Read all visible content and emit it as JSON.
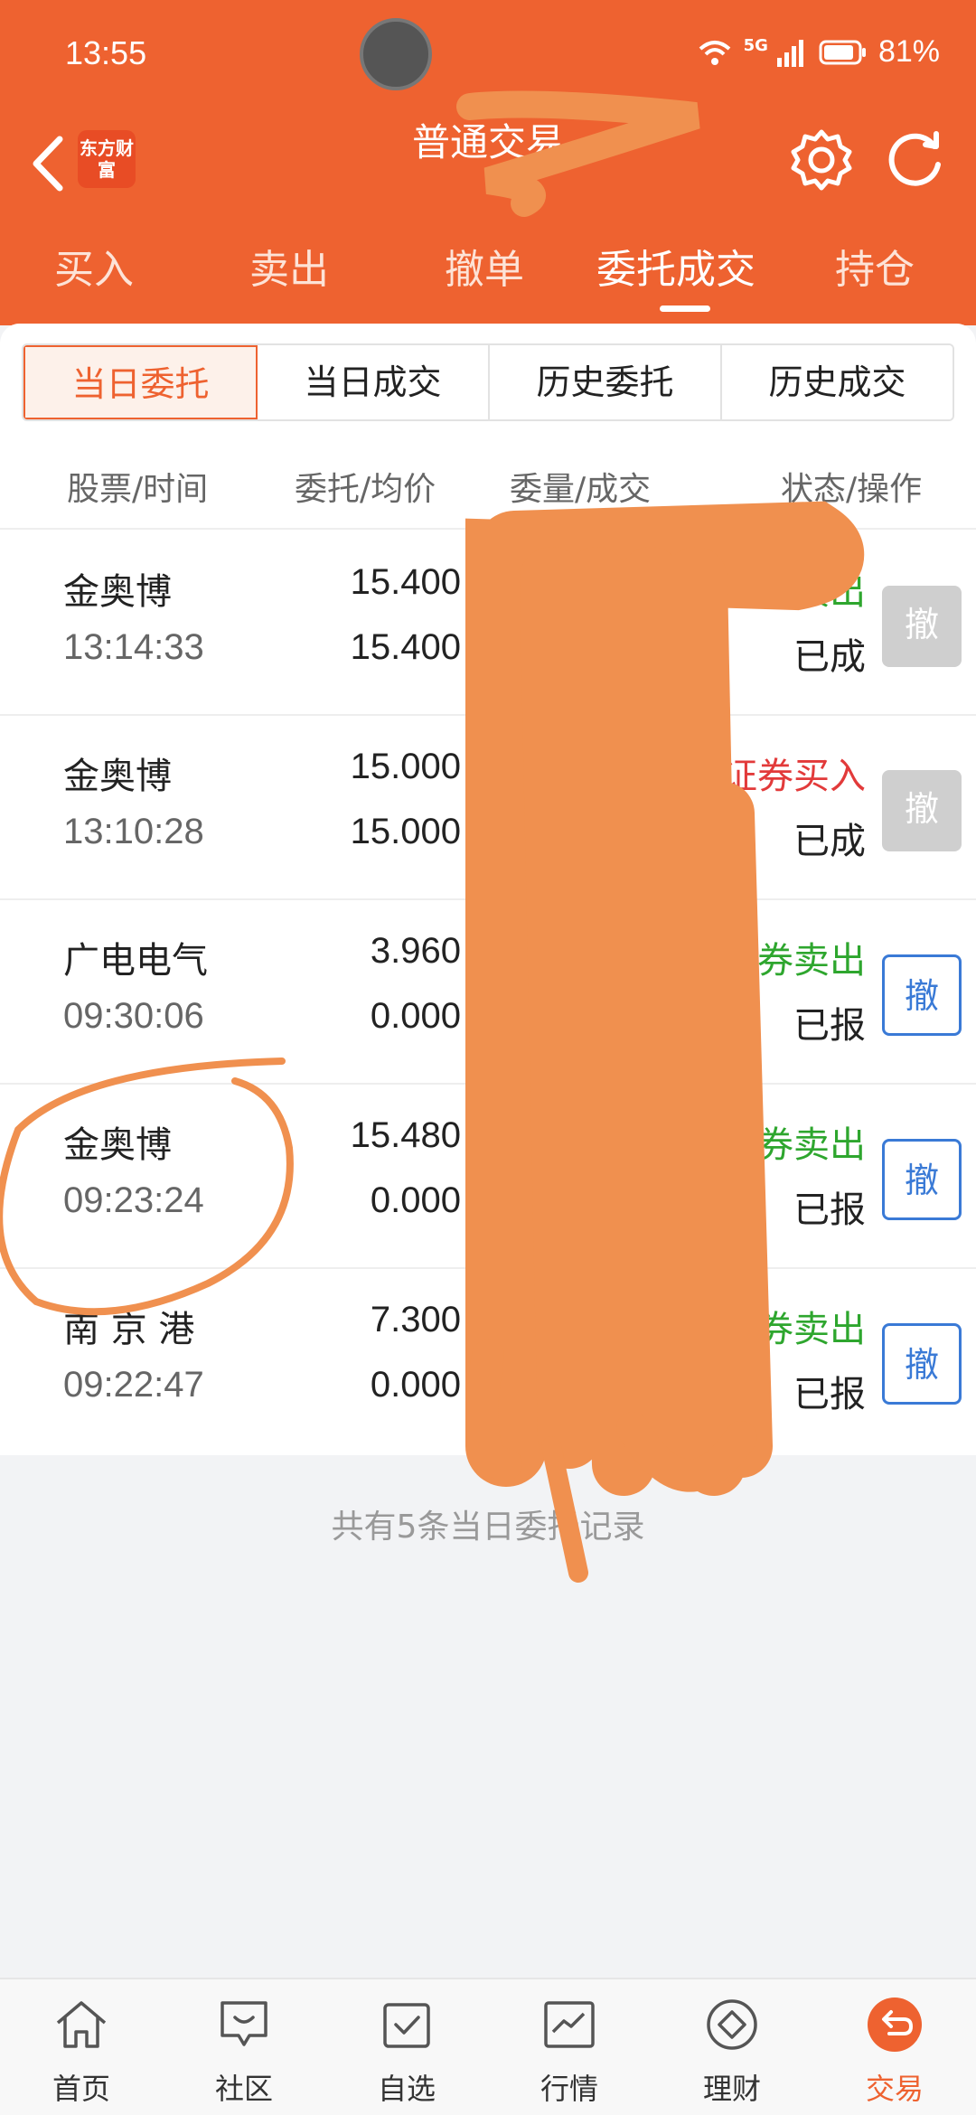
{
  "status_bar": {
    "time": "13:55",
    "network": "5G",
    "battery": "81%"
  },
  "header": {
    "logo_text": "东方财富",
    "title": "普通交易",
    "tabs": [
      {
        "label": "买入",
        "active": false
      },
      {
        "label": "卖出",
        "active": false
      },
      {
        "label": "撤单",
        "active": false
      },
      {
        "label": "委托成交",
        "active": true
      },
      {
        "label": "持仓",
        "active": false
      }
    ]
  },
  "segments": [
    {
      "label": "当日委托",
      "active": true
    },
    {
      "label": "当日成交",
      "active": false
    },
    {
      "label": "历史委托",
      "active": false
    },
    {
      "label": "历史成交",
      "active": false
    }
  ],
  "columns": {
    "stock_time": "股票/时间",
    "price_avg": "委托/均价",
    "qty_filled": "委量/成交",
    "status_op": "状态/操作"
  },
  "orders": [
    {
      "name": "金奥博",
      "time": "13:14:33",
      "price": "15.400",
      "avg": "15.400",
      "side": "证券卖出",
      "side_color": "#2ea62e",
      "status": "已成",
      "cancel_label": "撤",
      "cancel_enabled": false
    },
    {
      "name": "金奥博",
      "time": "13:10:28",
      "price": "15.000",
      "avg": "15.000",
      "side": "证券买入",
      "side_color": "#e23a3a",
      "status": "已成",
      "cancel_label": "撤",
      "cancel_enabled": false
    },
    {
      "name": "广电电气",
      "time": "09:30:06",
      "price": "3.960",
      "avg": "0.000",
      "side": "证券卖出",
      "side_color": "#2ea62e",
      "status": "已报",
      "cancel_label": "撤",
      "cancel_enabled": true
    },
    {
      "name": "金奥博",
      "time": "09:23:24",
      "price": "15.480",
      "avg": "0.000",
      "side": "证券卖出",
      "side_color": "#2ea62e",
      "status": "已报",
      "cancel_label": "撤",
      "cancel_enabled": true
    },
    {
      "name": "南 京 港",
      "time": "09:22:47",
      "price": "7.300",
      "avg": "0.000",
      "side": "证券卖出",
      "side_color": "#2ea62e",
      "status": "已报",
      "cancel_label": "撤",
      "cancel_enabled": true
    }
  ],
  "footer_note": "共有5条当日委托记录",
  "bottom_nav": [
    {
      "label": "首页",
      "icon": "home-icon",
      "active": false
    },
    {
      "label": "社区",
      "icon": "chat-icon",
      "active": false
    },
    {
      "label": "自选",
      "icon": "watchlist-icon",
      "active": false
    },
    {
      "label": "行情",
      "icon": "chart-icon",
      "active": false
    },
    {
      "label": "理财",
      "icon": "diamond-icon",
      "active": false
    },
    {
      "label": "交易",
      "icon": "trade-icon",
      "active": true
    }
  ],
  "colors": {
    "brand": "#ee6230",
    "sell": "#2ea62e",
    "buy": "#e23a3a",
    "cancel_blue": "#3a7ad6"
  }
}
